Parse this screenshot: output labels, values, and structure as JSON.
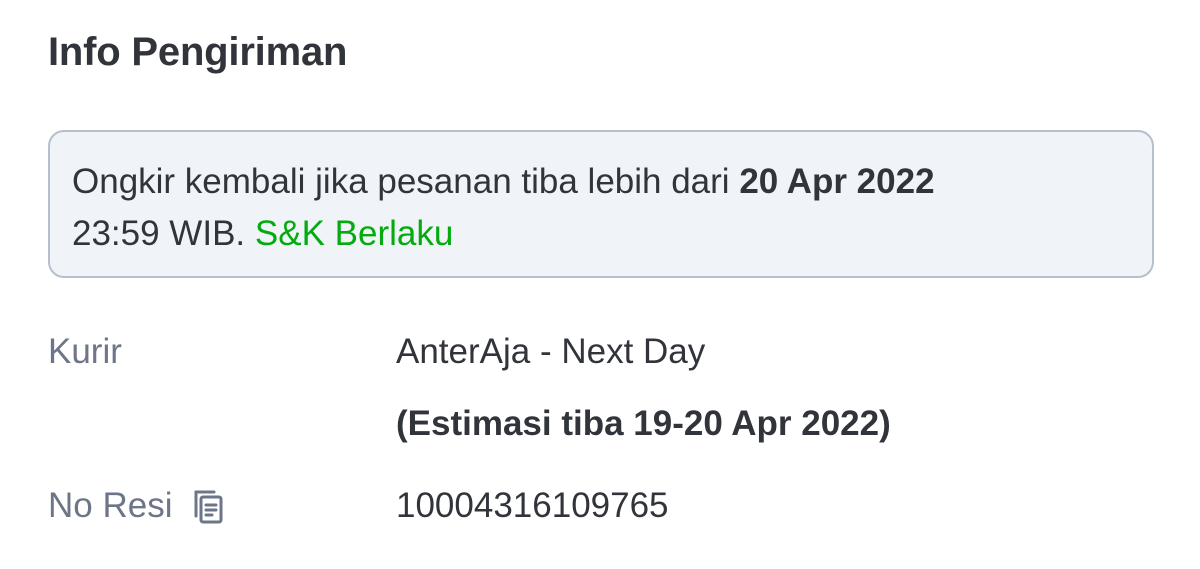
{
  "header": {
    "title": "Info Pengiriman"
  },
  "notice": {
    "text_before": "Ongkir kembali jika pesanan tiba lebih dari ",
    "deadline_date": "20 Apr 2022",
    "text_after": "23:59 WIB. ",
    "terms_link": "S&K Berlaku"
  },
  "courier": {
    "label": "Kurir",
    "value": "AnterAja - Next Day",
    "estimate": "(Estimasi tiba 19-20 Apr 2022)"
  },
  "receipt": {
    "label": "No Resi",
    "copy_icon": "copy-icon",
    "value": "10004316109765"
  },
  "colors": {
    "text_primary": "#31353b",
    "text_secondary": "#6d7588",
    "link_green": "#03ac0e",
    "notice_bg": "#f0f3f7",
    "notice_border": "#b5c0cc"
  }
}
